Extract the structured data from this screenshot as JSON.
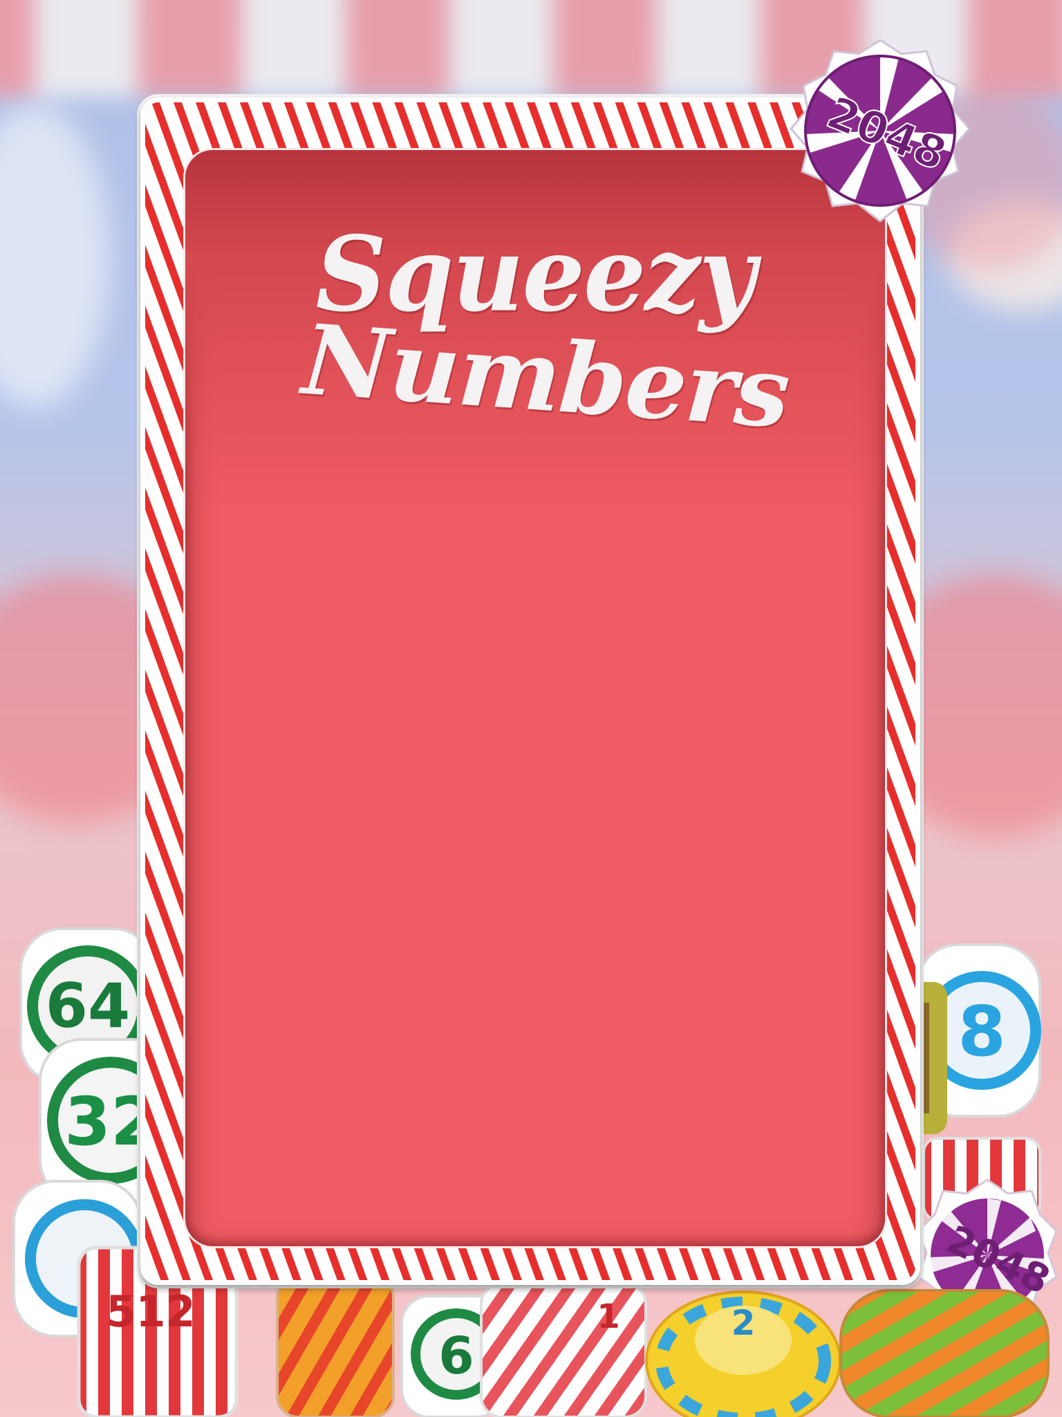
{
  "game": {
    "title_line1": "Squeezy",
    "title_line2": "Numbers",
    "badge_number": "2048"
  },
  "tiles": {
    "left_top": "64",
    "left_mid": "32",
    "left_red": "512",
    "right_blue": "8",
    "right_purple": "2048",
    "bottom_yellow": "2",
    "bottom_green": "6",
    "bottom_red": "1"
  },
  "colors": {
    "panel": "#ef5b62",
    "stripe_red": "#e62f2c",
    "title": "#f4f2f3",
    "badge_purple": "#8a2a8c"
  }
}
